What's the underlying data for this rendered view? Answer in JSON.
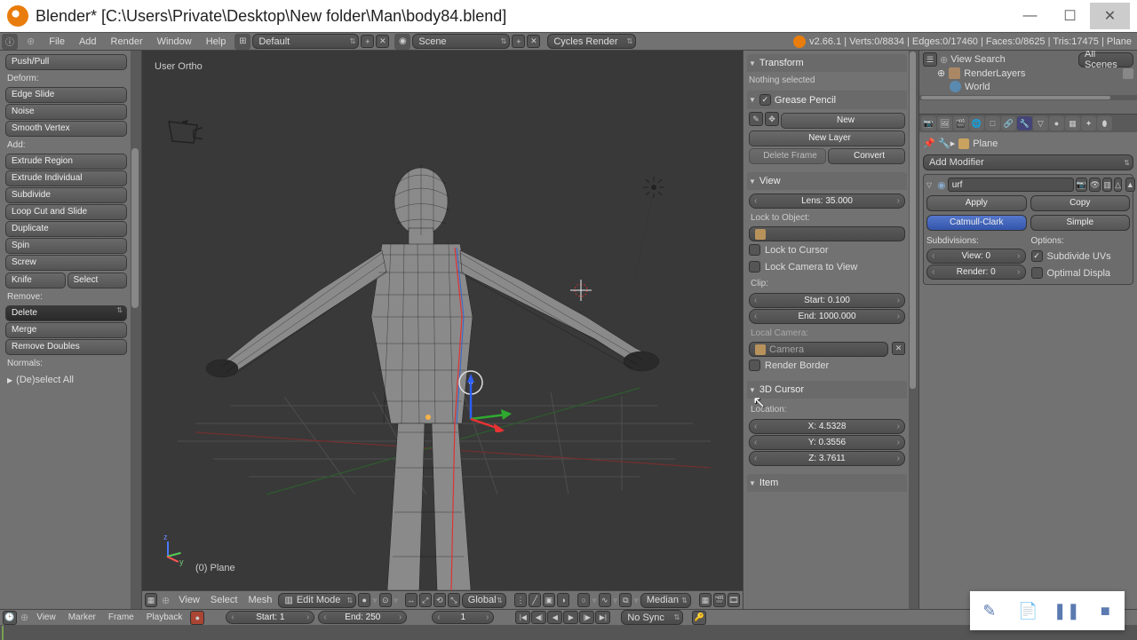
{
  "title": "Blender* [C:\\Users\\Private\\Desktop\\New folder\\Man\\body84.blend]",
  "menubar": {
    "items": [
      "File",
      "Add",
      "Render",
      "Window",
      "Help"
    ],
    "layout": "Default",
    "scene": "Scene",
    "engine": "Cycles Render",
    "stats": "v2.66.1 | Verts:0/8834 | Edges:0/17460 | Faces:0/8625 | Tris:17475 | Plane"
  },
  "left": {
    "group0_item": "Push/Pull",
    "deform_label": "Deform:",
    "deform": [
      "Edge Slide",
      "Noise",
      "Smooth Vertex"
    ],
    "add_label": "Add:",
    "add": [
      "Extrude Region",
      "Extrude Individual",
      "Subdivide",
      "Loop Cut and Slide",
      "Duplicate",
      "Spin",
      "Screw"
    ],
    "knife": "Knife",
    "select": "Select",
    "remove_label": "Remove:",
    "remove": [
      "Delete",
      "Merge",
      "Remove Doubles"
    ],
    "normals_label": "Normals:",
    "history": "(De)select All"
  },
  "viewport": {
    "persp": "User Ortho",
    "object_label": "(0) Plane",
    "header": {
      "view": "View",
      "select": "Select",
      "mesh": "Mesh",
      "mode": "Edit Mode",
      "orient": "Global",
      "pivot": "Median"
    }
  },
  "npanel": {
    "transform": "Transform",
    "nothing": "Nothing selected",
    "grease": "Grease Pencil",
    "new": "New",
    "new_layer": "New Layer",
    "delete_frame": "Delete Frame",
    "convert": "Convert",
    "view": "View",
    "lens": "Lens: 35.000",
    "lock_obj": "Lock to Object:",
    "lock_cursor": "Lock to Cursor",
    "lock_cam": "Lock Camera to View",
    "clip": "Clip:",
    "clip_start": "Start: 0.100",
    "clip_end": "End: 1000.000",
    "local_cam": "Local Camera:",
    "camera": "Camera",
    "render_border": "Render Border",
    "cursor_hdr": "3D Cursor",
    "location": "Location:",
    "x": "X: 4.5328",
    "y": "Y: 0.3556",
    "z": "Z: 3.7611",
    "item": "Item"
  },
  "outliner": {
    "search": "Search",
    "all_scenes": "All Scenes",
    "view": "View",
    "items": [
      "RenderLayers",
      "World"
    ]
  },
  "props": {
    "datablock": "Plane",
    "add_modifier": "Add Modifier",
    "mod_name": "urf",
    "apply": "Apply",
    "copy": "Copy",
    "catmull": "Catmull-Clark",
    "simple": "Simple",
    "subdiv": "Subdivisions:",
    "options": "Options:",
    "view_n": "View: 0",
    "render_n": "Render: 0",
    "sub_uv": "Subdivide UVs",
    "opt_disp": "Optimal Displa"
  },
  "timeline": {
    "view": "View",
    "marker": "Marker",
    "frame": "Frame",
    "playback": "Playback",
    "start": "Start: 1",
    "end": "End: 250",
    "cur": "1",
    "sync": "No Sync"
  }
}
